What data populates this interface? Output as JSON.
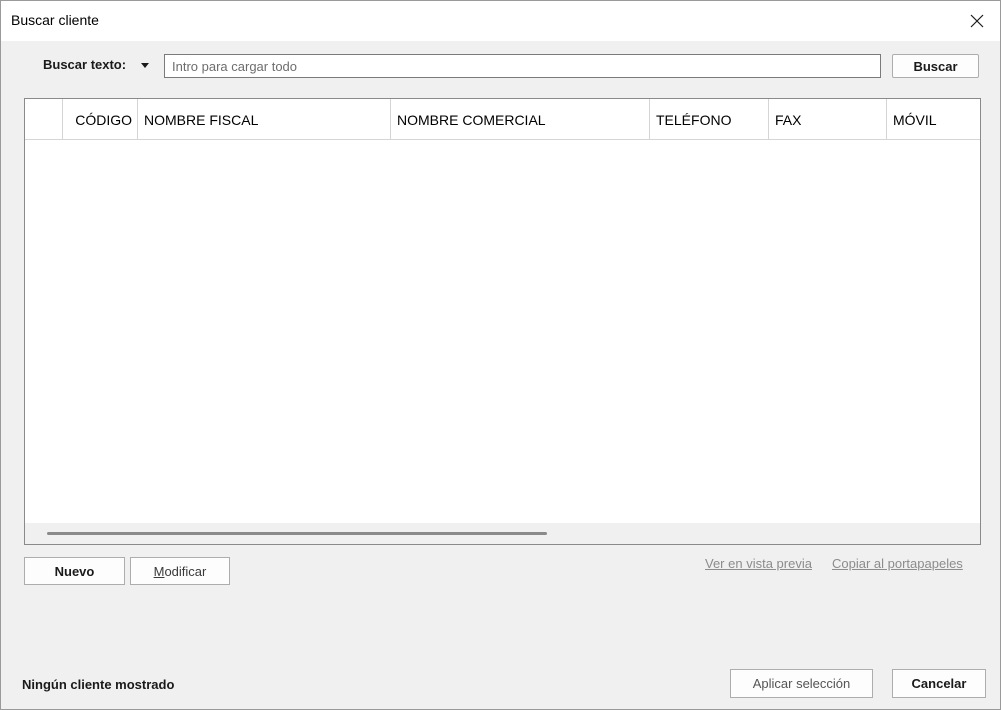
{
  "window": {
    "title": "Buscar cliente",
    "close_icon": "close-icon"
  },
  "search": {
    "label": "Buscar texto:",
    "dropdown_icon": "caret-down-icon",
    "value": "",
    "placeholder": "Intro para cargar todo",
    "button_label": "Buscar"
  },
  "grid": {
    "columns": [
      "",
      "CÓDIGO",
      "NOMBRE FISCAL",
      "NOMBRE COMERCIAL",
      "TELÉFONO",
      "FAX",
      "MÓVIL"
    ],
    "rows": []
  },
  "actions": {
    "new_label": "Nuevo",
    "modify_label_underlined": "M",
    "modify_label_rest": "odificar",
    "preview_link": "Ver en vista previa",
    "copy_link": "Copiar al portapapeles"
  },
  "footer": {
    "status": "Ningún cliente mostrado",
    "apply_label": "Aplicar selección",
    "cancel_label": "Cancelar"
  }
}
